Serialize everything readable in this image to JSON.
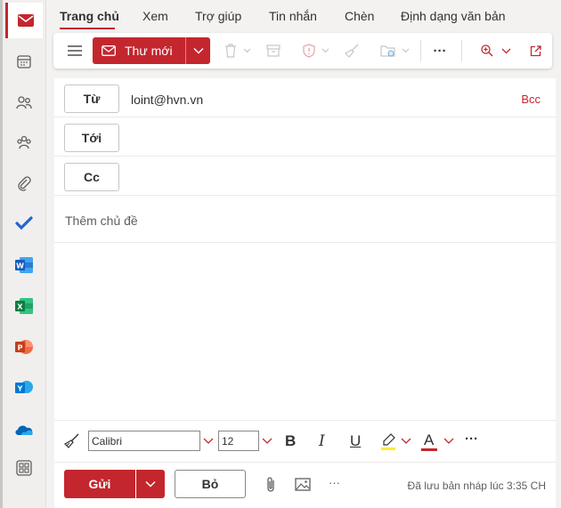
{
  "tabs": [
    {
      "label": "Trang chủ",
      "active": true
    },
    {
      "label": "Xem"
    },
    {
      "label": "Trợ giúp"
    },
    {
      "label": "Tin nhắn"
    },
    {
      "label": "Chèn"
    },
    {
      "label": "Định dạng văn bản"
    }
  ],
  "ribbon": {
    "new_mail_label": "Thư mới",
    "more_label": "···"
  },
  "compose": {
    "from_label": "Từ",
    "from_value": "loint@hvn.vn",
    "bcc_label": "Bcc",
    "to_label": "Tới",
    "cc_label": "Cc",
    "subject_placeholder": "Thêm chủ đề"
  },
  "format": {
    "font": "Calibri",
    "size": "12",
    "bold": "B",
    "italic": "I",
    "underline": "U",
    "font_color_glyph": "A",
    "more": "···"
  },
  "sendbar": {
    "send_label": "Gửi",
    "discard_label": "Bỏ",
    "more": "···",
    "draft_status": "Đã lưu bản nháp lúc 3:35 CH"
  },
  "colors": {
    "accent": "#c4262e",
    "highlight": "#ffeb3b",
    "font_color": "#c4262e"
  },
  "rail_icons": [
    "mail-icon",
    "calendar-icon",
    "people-icon",
    "groups-icon",
    "attachment-icon",
    "todo-icon",
    "word-icon",
    "excel-icon",
    "powerpoint-icon",
    "yammer-icon",
    "onedrive-icon",
    "apps-icon"
  ]
}
